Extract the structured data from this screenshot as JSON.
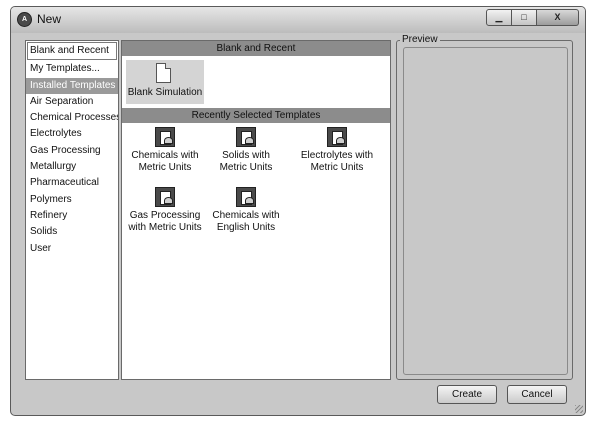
{
  "window": {
    "title": "New",
    "app_icon": "aspen-logo-icon",
    "min_glyph": "▁",
    "max_glyph": "□",
    "close_glyph": "X"
  },
  "categories": [
    "Blank and Recent",
    "My Templates...",
    "Installed Templates",
    "Air Separation",
    "Chemical Processes",
    "Electrolytes",
    "Gas Processing",
    "Metallurgy",
    "Pharmaceutical",
    "Polymers",
    "Refinery",
    "Solids",
    "User"
  ],
  "templates_panel": {
    "blank_header": "Blank and Recent",
    "blank_tile_label": "Blank Simulation",
    "recent_header": "Recently Selected Templates",
    "recent": [
      [
        "Chemicals with",
        "Metric Units"
      ],
      [
        "Solids with",
        "Metric Units"
      ],
      [
        "Electrolytes with",
        "Metric Units"
      ],
      [
        "Gas Processing",
        "with Metric Units"
      ],
      [
        "Chemicals with",
        "English Units"
      ]
    ]
  },
  "preview": {
    "label": "Preview"
  },
  "buttons": {
    "create": "Create",
    "cancel": "Cancel"
  }
}
